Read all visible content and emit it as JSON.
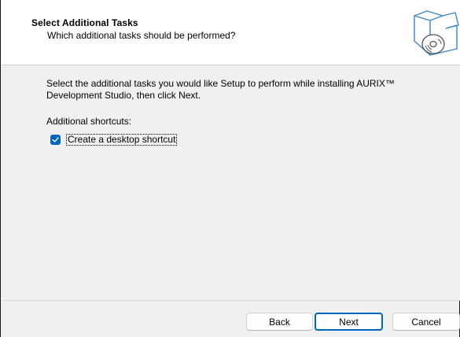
{
  "header": {
    "title": "Select Additional Tasks",
    "subtitle": "Which additional tasks should be performed?"
  },
  "body": {
    "intro": "Select the additional tasks you would like Setup to perform while installing AURIX™ Development Studio, then click Next.",
    "group_label": "Additional shortcuts:",
    "tasks": [
      {
        "label": "Create a desktop shortcut",
        "checked": true
      }
    ]
  },
  "buttons": {
    "back": "Back",
    "next": "Next",
    "cancel": "Cancel"
  },
  "colors": {
    "accent": "#0067c0",
    "dialog_bg": "#f0f0f0",
    "header_bg": "#ffffff"
  },
  "icons": {
    "wizard": "setup-box-disc-icon",
    "check": "checkmark-icon"
  }
}
